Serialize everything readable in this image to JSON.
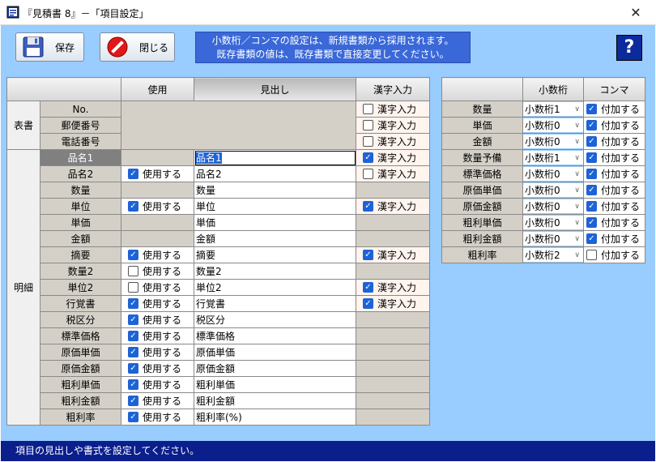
{
  "window": {
    "title": "『見積書 8』－「項目設定」",
    "close_symbol": "✕"
  },
  "toolbar": {
    "save_label": "保存",
    "close_label": "閉じる"
  },
  "info": {
    "line1": "小数桁／コンマの設定は、新規書類から採用されます。",
    "line2": "既存書類の値は、既存書類で直接変更してください。"
  },
  "help_label": "?",
  "main_table": {
    "col_use": "使用",
    "col_heading": "見出し",
    "col_kanji": "漢字入力",
    "use_label": "使用する",
    "kanji_label": "漢字入力",
    "sections": [
      {
        "name": "表書",
        "rows": [
          {
            "label": "No.",
            "use": null,
            "heading": null,
            "kanji": false
          },
          {
            "label": "郵便番号",
            "use": null,
            "heading": null,
            "kanji": false
          },
          {
            "label": "電話番号",
            "use": null,
            "heading": null,
            "kanji": false
          }
        ]
      },
      {
        "name": "明細",
        "rows": [
          {
            "label": "品名1",
            "use": null,
            "heading": "品名1",
            "kanji": true
          },
          {
            "label": "品名2",
            "use": true,
            "heading": "品名2",
            "kanji": false
          },
          {
            "label": "数量",
            "use": null,
            "heading": "数量",
            "kanji": null
          },
          {
            "label": "単位",
            "use": true,
            "heading": "単位",
            "kanji": true
          },
          {
            "label": "単価",
            "use": null,
            "heading": "単価",
            "kanji": null
          },
          {
            "label": "金額",
            "use": null,
            "heading": "金額",
            "kanji": null
          },
          {
            "label": "摘要",
            "use": true,
            "heading": "摘要",
            "kanji": true
          },
          {
            "label": "数量2",
            "use": false,
            "heading": "数量2",
            "kanji": null
          },
          {
            "label": "単位2",
            "use": false,
            "heading": "単位2",
            "kanji": true
          },
          {
            "label": "行覚書",
            "use": true,
            "heading": "行覚書",
            "kanji": true
          },
          {
            "label": "税区分",
            "use": true,
            "heading": "税区分",
            "kanji": null
          },
          {
            "label": "標準価格",
            "use": true,
            "heading": "標準価格",
            "kanji": null
          },
          {
            "label": "原価単価",
            "use": true,
            "heading": "原価単価",
            "kanji": null
          },
          {
            "label": "原価金額",
            "use": true,
            "heading": "原価金額",
            "kanji": null
          },
          {
            "label": "粗利単価",
            "use": true,
            "heading": "粗利単価",
            "kanji": null
          },
          {
            "label": "粗利金額",
            "use": true,
            "heading": "粗利金額",
            "kanji": null
          },
          {
            "label": "粗利率",
            "use": true,
            "heading": "粗利率(%)",
            "kanji": null
          }
        ]
      }
    ]
  },
  "side_table": {
    "col_decimal": "小数桁",
    "col_comma": "コンマ",
    "comma_label": "付加する",
    "rows": [
      {
        "label": "数量",
        "decimal": "小数桁1",
        "comma": true
      },
      {
        "label": "単価",
        "decimal": "小数桁0",
        "comma": true
      },
      {
        "label": "金額",
        "decimal": "小数桁0",
        "comma": true
      },
      {
        "label": "数量予備",
        "decimal": "小数桁1",
        "comma": true
      },
      {
        "label": "標準価格",
        "decimal": "小数桁0",
        "comma": true
      },
      {
        "label": "原価単価",
        "decimal": "小数桁0",
        "comma": true
      },
      {
        "label": "原価金額",
        "decimal": "小数桁0",
        "comma": true
      },
      {
        "label": "粗利単価",
        "decimal": "小数桁0",
        "comma": true
      },
      {
        "label": "粗利金額",
        "decimal": "小数桁0",
        "comma": true
      },
      {
        "label": "粗利率",
        "decimal": "小数桁2",
        "comma": false
      }
    ]
  },
  "status": {
    "message": "項目の見出しや書式を設定してください。"
  },
  "colors": {
    "client_bg": "#99ccff",
    "info_bg": "#3a68d8",
    "status_bg": "#0a1e8c",
    "check_on": "#1e63d6"
  }
}
